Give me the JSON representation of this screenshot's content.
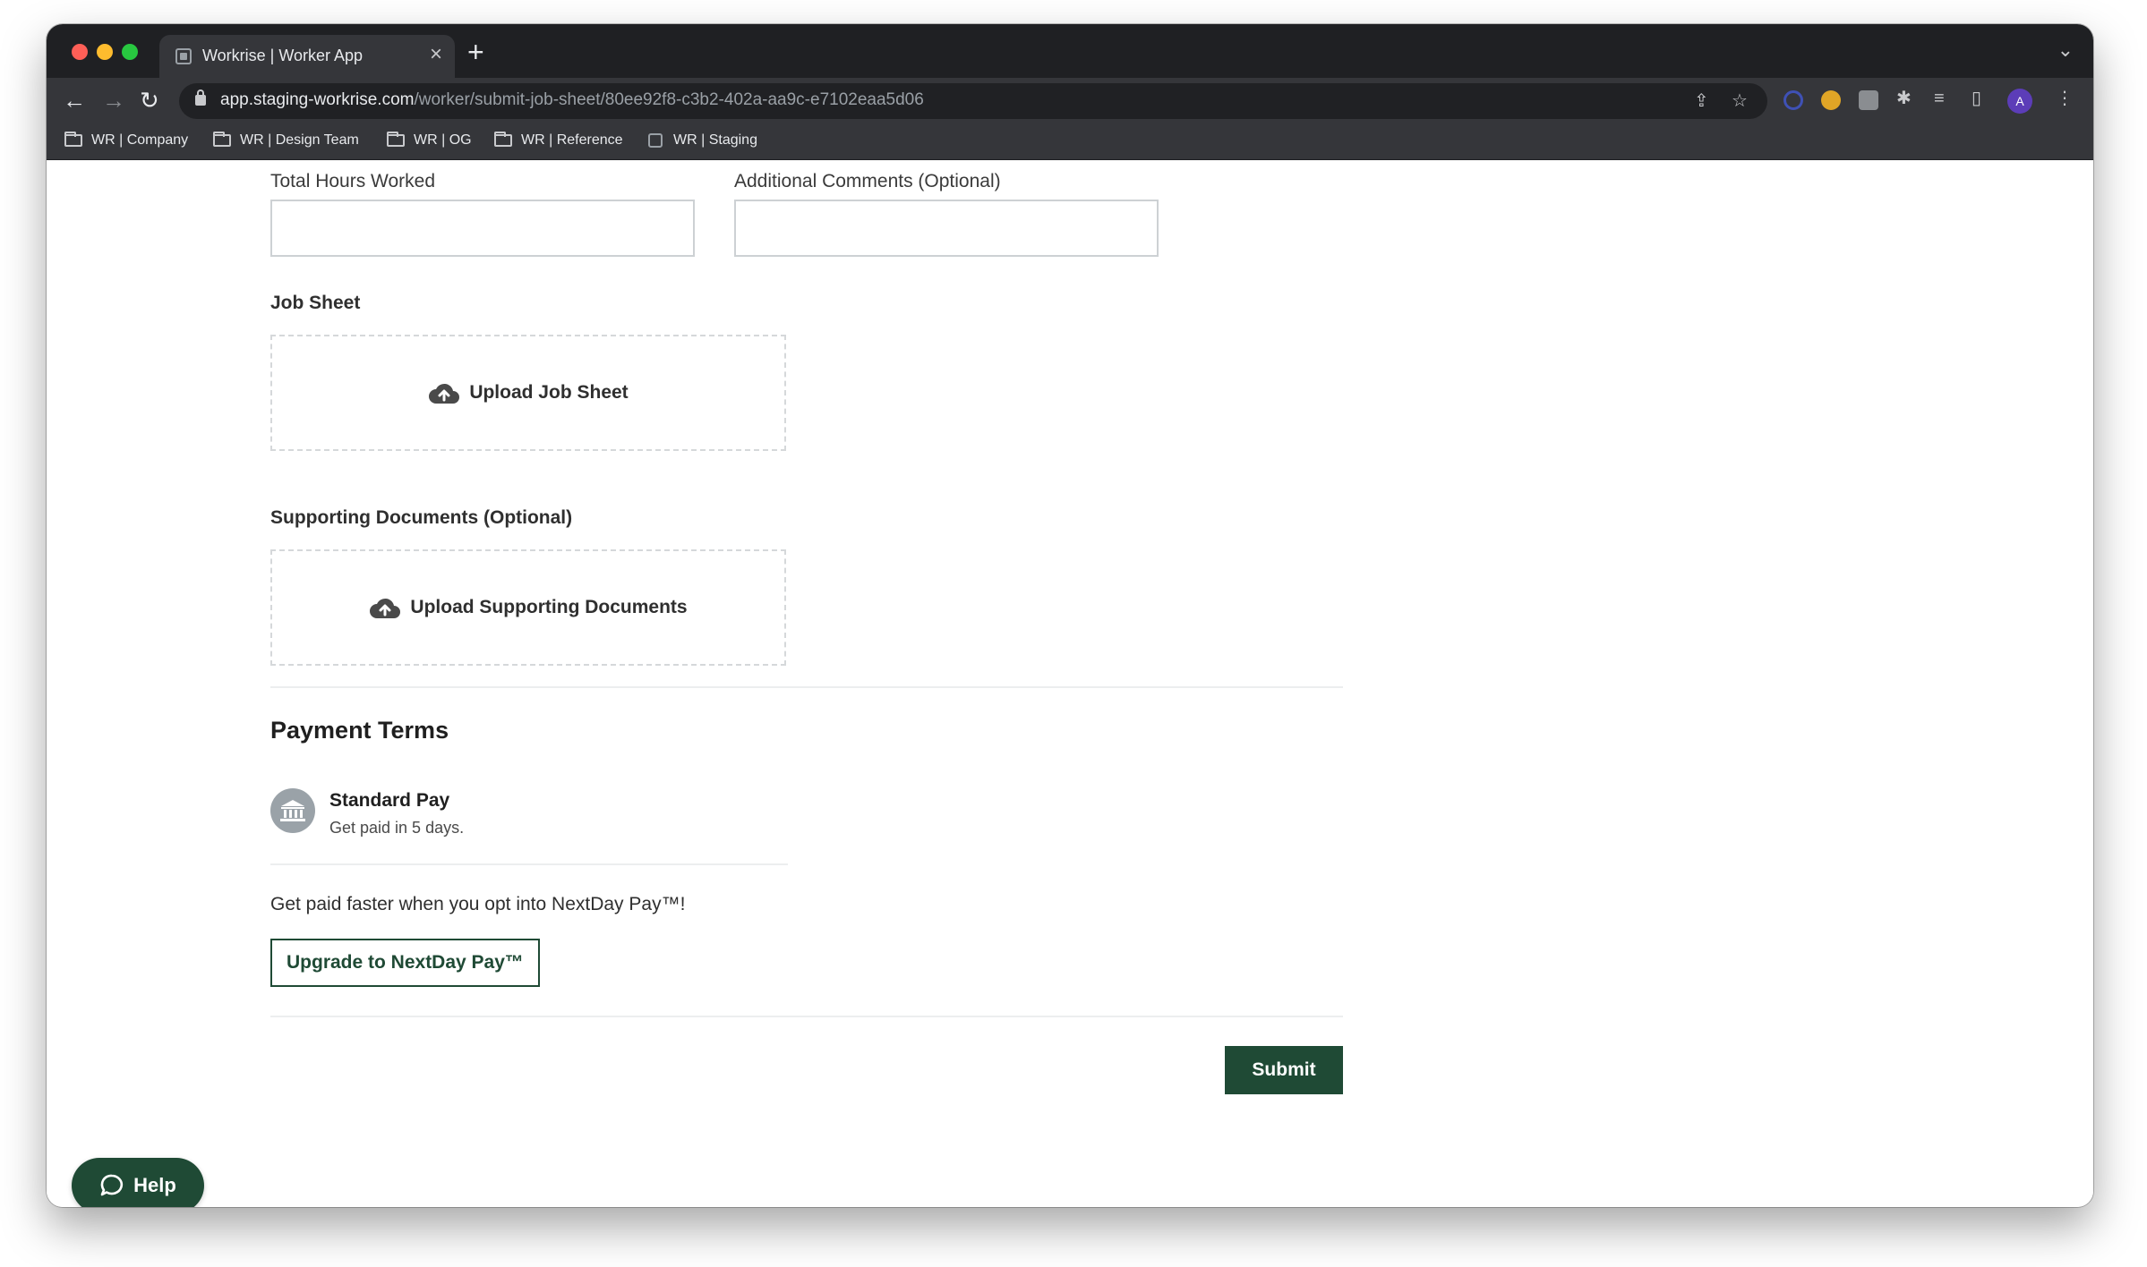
{
  "browser": {
    "tab_title": "Workrise | Worker App",
    "new_tab_glyph": "+",
    "url_host": "app.staging-workrise.com",
    "url_path": "/worker/submit-job-sheet/80ee92f8-c3b2-402a-aa9c-e7102eaa5d06",
    "profile_initial": "A",
    "bookmarks": [
      {
        "label": "WR | Company",
        "icon": "folder-icon"
      },
      {
        "label": "WR | Design Team",
        "icon": "folder-icon"
      },
      {
        "label": "WR | OG",
        "icon": "folder-icon"
      },
      {
        "label": "WR | Reference",
        "icon": "folder-icon"
      },
      {
        "label": "WR | Staging",
        "icon": "site-favicon-icon"
      }
    ]
  },
  "form": {
    "total_hours": {
      "label": "Total Hours Worked",
      "value": ""
    },
    "comments": {
      "label": "Additional Comments (Optional)",
      "value": ""
    },
    "job_sheet": {
      "label": "Job Sheet",
      "upload_label": "Upload Job Sheet"
    },
    "supporting_docs": {
      "label": "Supporting Documents (Optional)",
      "upload_label": "Upload Supporting Documents"
    }
  },
  "payment": {
    "section_title": "Payment Terms",
    "plan_title": "Standard Pay",
    "plan_subtitle": "Get paid in 5 days.",
    "promo_text": "Get paid faster when you opt into NextDay Pay™!",
    "upgrade_label": "Upgrade to NextDay Pay™"
  },
  "actions": {
    "submit_label": "Submit",
    "help_label": "Help"
  },
  "colors": {
    "brand_green": "#1f4a35",
    "chrome_dark": "#35363a"
  }
}
